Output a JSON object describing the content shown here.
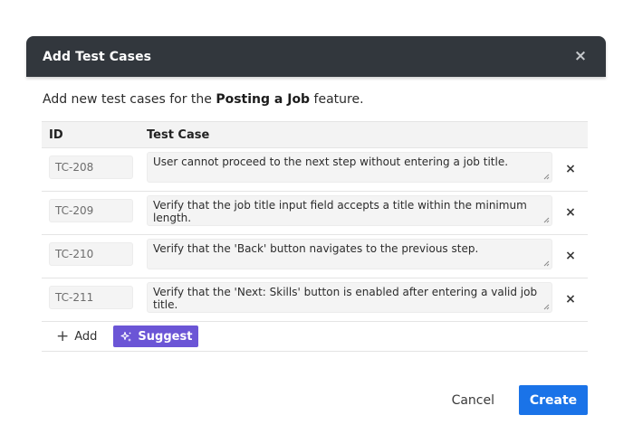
{
  "dialog": {
    "title": "Add Test Cases",
    "close_glyph": "×",
    "description_prefix": "Add new test cases for the ",
    "feature_name": "Posting a Job",
    "description_suffix": " feature."
  },
  "table": {
    "headers": {
      "id": "ID",
      "test_case": "Test Case"
    },
    "rows": [
      {
        "id": "TC-208",
        "text": "User cannot proceed to the next step without entering a job title."
      },
      {
        "id": "TC-209",
        "text": "Verify that the job title input field accepts a title within the minimum length."
      },
      {
        "id": "TC-210",
        "text": "Verify that the 'Back' button navigates to the previous step."
      },
      {
        "id": "TC-211",
        "text": "Verify that the 'Next: Skills' button is enabled after entering a valid job title."
      }
    ],
    "remove_glyph": "×"
  },
  "actions": {
    "add_label": "Add",
    "add_glyph": "+",
    "suggest_label": "Suggest"
  },
  "footer": {
    "cancel_label": "Cancel",
    "create_label": "Create"
  },
  "colors": {
    "header_bg": "#32373d",
    "suggest_bg": "#6b55d6",
    "create_bg": "#1a73e8"
  },
  "icons": {
    "close": "close-icon",
    "remove": "close-icon",
    "add": "plus-icon",
    "suggest": "sparkle-icon",
    "resize": "resize-handle-icon"
  }
}
